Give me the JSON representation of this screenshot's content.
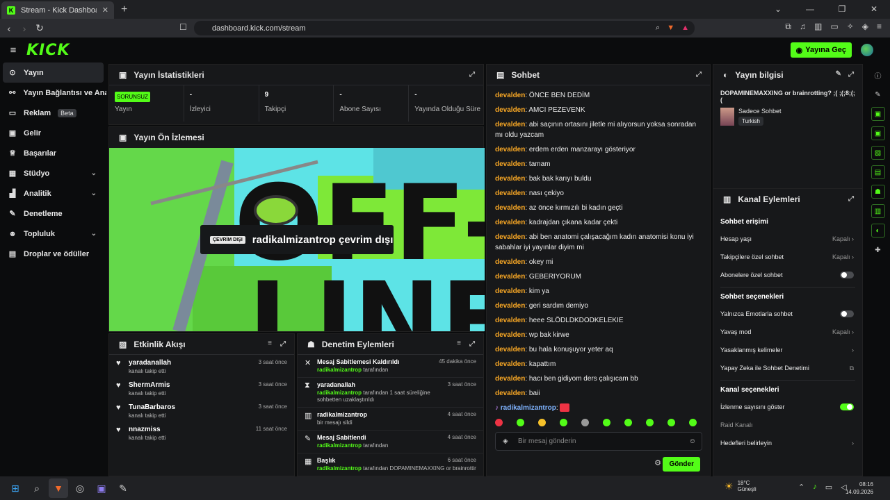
{
  "browser": {
    "tab_title": "Stream - Kick Dashboard",
    "url": "dashboard.kick.com/stream"
  },
  "topbar": {
    "logo": "KICK",
    "go_live": "Yayına Geç"
  },
  "sidebar": {
    "items": [
      {
        "label": "Yayın",
        "icon": "circle-icon"
      },
      {
        "label": "Yayın Bağlantısı ve Anahtarı",
        "icon": "link-icon"
      },
      {
        "label": "Reklam",
        "icon": "ad-icon",
        "badge": "Beta"
      },
      {
        "label": "Gelir",
        "icon": "money-icon"
      },
      {
        "label": "Başarılar",
        "icon": "trophy-icon"
      },
      {
        "label": "Stüdyo",
        "icon": "studio-icon"
      },
      {
        "label": "Analitik",
        "icon": "chart-icon"
      },
      {
        "label": "Denetleme",
        "icon": "wrench-icon"
      },
      {
        "label": "Topluluk",
        "icon": "users-icon"
      },
      {
        "label": "Droplar ve ödüller",
        "icon": "gift-icon"
      }
    ]
  },
  "stats": {
    "title": "Yayın İstatistikleri",
    "cells": [
      {
        "value": "SORUNSUZ",
        "label": "Yayın"
      },
      {
        "value": "-",
        "label": "İzleyici"
      },
      {
        "value": "9",
        "label": "Takipçi"
      },
      {
        "value": "-",
        "label": "Abone Sayısı"
      },
      {
        "value": "-",
        "label": "Yayında Olduğu Süre"
      }
    ]
  },
  "preview": {
    "title": "Yayın Ön İzlemesi",
    "badge": "ÇEVRİM DIŞI",
    "status": "radikalmizantrop çevrim dışı",
    "bg_text_1": "OFF-",
    "bg_text_2": "LINE"
  },
  "activity": {
    "title": "Etkinlik Akışı",
    "items": [
      {
        "name": "yaradanallah",
        "sub": "kanalı takip etti",
        "time": "3 saat önce"
      },
      {
        "name": "ShermArmis",
        "sub": "kanalı takip etti",
        "time": "3 saat önce"
      },
      {
        "name": "TunaBarbaros",
        "sub": "kanalı takip etti",
        "time": "3 saat önce"
      },
      {
        "name": "nnazmiss",
        "sub": "kanalı takip etti",
        "time": "11 saat önce"
      }
    ]
  },
  "moderation": {
    "title": "Denetim Eylemleri",
    "items": [
      {
        "title": "Mesaj Sabitlemesi Kaldırıldı",
        "user": "radikalmizantrop",
        "rest": " tarafından",
        "time": "45 dakika önce"
      },
      {
        "title": "yaradanallah",
        "user": "radikalmizantrop",
        "rest": " tarafından 1 saat süreliğine sohbetten uzaklaştırıldı",
        "time": "3 saat önce"
      },
      {
        "title": "radikalmizantrop",
        "user": "",
        "rest": "bir mesajı sildi",
        "time": "4 saat önce"
      },
      {
        "title": "Mesaj Sabitlendi",
        "user": "radikalmizantrop",
        "rest": " tarafından",
        "time": "4 saat önce"
      },
      {
        "title": "Başlık",
        "user": "radikalmizantrop",
        "rest": " tarafından DOPAMINEMAXXING or brainrotting?",
        "time": "6 saat önce"
      }
    ]
  },
  "chat": {
    "title": "Sohbet",
    "messages": [
      {
        "user": "devalden",
        "text": "ÖNCE BEN DEDİM"
      },
      {
        "user": "devalden",
        "text": "AMCI PEZEVENK"
      },
      {
        "user": "devalden",
        "text": "abi saçının ortasını jiletle mi alıyorsun yoksa sonradan mı oldu yazcam"
      },
      {
        "user": "devalden",
        "text": "erdem erden manzarayı gösteriyor"
      },
      {
        "user": "devalden",
        "text": "tamam"
      },
      {
        "user": "devalden",
        "text": "bak bak karıyı buldu"
      },
      {
        "user": "devalden",
        "text": "nası çekiyo"
      },
      {
        "user": "devalden",
        "text": "az önce kırmızılı bi kadın geçti"
      },
      {
        "user": "devalden",
        "text": "kadrajdan çıkana kadar çekti"
      },
      {
        "user": "devalden",
        "text": "abi ben anatomi çalışacağım kadın anatomisi konu iyi sabahlar iyi yayınlar diyim mi"
      },
      {
        "user": "devalden",
        "text": "okey mi"
      },
      {
        "user": "devalden",
        "text": "GEBERIYORUM"
      },
      {
        "user": "devalden",
        "text": "kim ya"
      },
      {
        "user": "devalden",
        "text": "geri sardım demiyo"
      },
      {
        "user": "devalden",
        "text": "heee SLÖDLDKDODKELEKIE"
      },
      {
        "user": "devalden",
        "text": "wp bak kirwe"
      },
      {
        "user": "devalden",
        "text": "bu hala konuşuyor yeter aq"
      },
      {
        "user": "devalden",
        "text": "kapattım"
      },
      {
        "user": "devalden",
        "text": "hacı ben gidiyom ders çalışıcam bb"
      },
      {
        "user": "devalden",
        "text": "baii"
      }
    ],
    "mod_user": "radikalmizantrop",
    "placeholder": "Bir mesaj gönderin",
    "send": "Gönder"
  },
  "stream_info": {
    "title": "Yayın bilgisi",
    "stream_title": "DOPAMINEMAXXING or brainrotting? ;( ;(;8;(;(",
    "category": "Sadece Sohbet",
    "language": "Turkish"
  },
  "channel_actions": {
    "title": "Kanal Eylemleri",
    "chat_access": "Sohbet erişimi",
    "account_age": "Hesap yaşı",
    "account_age_val": "Kapalı",
    "followers_only": "Takipçilere özel sohbet",
    "followers_only_val": "Kapalı",
    "subs_only": "Abonelere özel sohbet",
    "chat_options": "Sohbet seçenekleri",
    "emote_only": "Yalnızca Emotlarla sohbet",
    "slow_mode": "Yavaş mod",
    "slow_mode_val": "Kapalı",
    "banned_words": "Yasaklanmış kelimeler",
    "ai_moderation": "Yapay Zeka ile Sohbet Denetimi",
    "channel_options": "Kanal seçenekleri",
    "show_viewers": "İzlenme sayısını göster",
    "raid": "Raid Kanalı",
    "goals": "Hedefleri belirleyin"
  },
  "taskbar": {
    "temp": "18°C",
    "weather": "Güneşli",
    "time": "08:16",
    "date": "14.09.2026"
  },
  "colors": {
    "accent": "#53fc18",
    "username": "#f9a825",
    "background": "#0b0c0d"
  }
}
